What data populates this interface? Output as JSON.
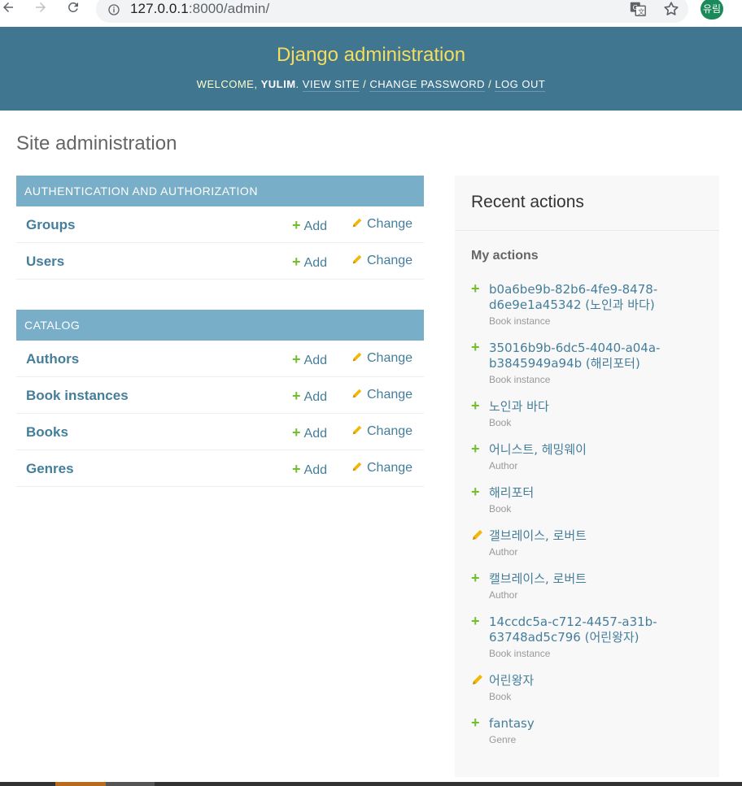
{
  "browser": {
    "url_host": "127.0.0.1",
    "url_rest": ":8000/admin/",
    "profile_initial": "유림"
  },
  "header": {
    "site_name": "Django administration",
    "welcome": "WELCOME,",
    "username": "YULIM",
    "view_site": "VIEW SITE",
    "change_password": "CHANGE PASSWORD",
    "log_out": "LOG OUT"
  },
  "page_title": "Site administration",
  "modules": [
    {
      "caption": "AUTHENTICATION AND AUTHORIZATION",
      "models": [
        {
          "name": "Groups",
          "add": "Add",
          "change": "Change"
        },
        {
          "name": "Users",
          "add": "Add",
          "change": "Change"
        }
      ]
    },
    {
      "caption": "CATALOG",
      "models": [
        {
          "name": "Authors",
          "add": "Add",
          "change": "Change"
        },
        {
          "name": "Book instances",
          "add": "Add",
          "change": "Change"
        },
        {
          "name": "Books",
          "add": "Add",
          "change": "Change"
        },
        {
          "name": "Genres",
          "add": "Add",
          "change": "Change"
        }
      ]
    }
  ],
  "recent_actions": {
    "title": "Recent actions",
    "subtitle": "My actions",
    "items": [
      {
        "kind": "add",
        "line1": "b0a6be9b-82b6-4fe9-8478-",
        "line2": "d6e9e1a45342 (노인과 바다)",
        "type": "Book instance"
      },
      {
        "kind": "add",
        "line1": "35016b9b-6dc5-4040-a04a-",
        "line2": "b3845949a94b (해리포터)",
        "type": "Book instance"
      },
      {
        "kind": "add",
        "line1": "노인과 바다",
        "line2": "",
        "type": "Book"
      },
      {
        "kind": "add",
        "line1": "어니스트, 헤밍웨이",
        "line2": "",
        "type": "Author"
      },
      {
        "kind": "add",
        "line1": "해리포터",
        "line2": "",
        "type": "Book"
      },
      {
        "kind": "change",
        "line1": "갤브레이스, 로버트",
        "line2": "",
        "type": "Author"
      },
      {
        "kind": "add",
        "line1": "캘브레이스, 로버트",
        "line2": "",
        "type": "Author"
      },
      {
        "kind": "add",
        "line1": "14ccdc5a-c712-4457-a31b-",
        "line2": "63748ad5c796 (어린왕자)",
        "type": "Book instance"
      },
      {
        "kind": "change",
        "line1": "어린왕자",
        "line2": "",
        "type": "Book"
      },
      {
        "kind": "add",
        "line1": "fantasy",
        "line2": "",
        "type": "Genre"
      }
    ]
  },
  "colors": {
    "header_bg": "#417690",
    "branding": "#f5dd5d",
    "caption_bg": "#79aec8",
    "link": "#447e9b",
    "add_green": "#70bf2b",
    "pencil_yellow": "#efb80b"
  },
  "icons": {
    "back": "arrow-left-icon",
    "forward": "arrow-right-icon",
    "reload": "reload-icon",
    "info": "info-icon",
    "translate": "translate-icon",
    "bookmark": "star-icon",
    "add": "plus-icon",
    "change": "pencil-icon"
  }
}
